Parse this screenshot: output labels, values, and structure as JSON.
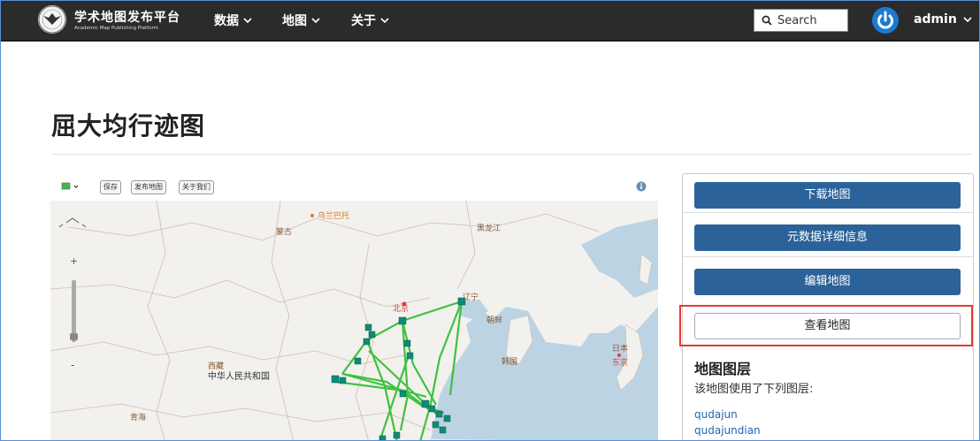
{
  "navbar": {
    "brand_main": "学术地图发布平台",
    "brand_sub": "Academic Map Publishing Platform",
    "menu": [
      {
        "label": "数据"
      },
      {
        "label": "地图"
      },
      {
        "label": "关于"
      }
    ],
    "search_placeholder": "Search",
    "user": "admin"
  },
  "page": {
    "title": "屈大均行迹图"
  },
  "map": {
    "toolbar": {
      "save": "保存",
      "publish": "发布地图",
      "about": "关于我们"
    },
    "labels": [
      "乌兰巴托",
      "蒙古",
      "黑龙江",
      "北京",
      "辽宁",
      "朝鲜",
      "韩国",
      "日本",
      "东京",
      "中华人民共和国",
      "西藏",
      "青海"
    ],
    "route_color": "#3ec23e",
    "point_color": "#0f8a78"
  },
  "sidebar": {
    "download": "下载地图",
    "metadata": "元数据详细信息",
    "edit": "编辑地图",
    "view": "查看地图",
    "layers_title": "地图图层",
    "layers_desc": "该地图使用了下列图层:",
    "layers": [
      "qudajun",
      "qudajundian"
    ]
  }
}
